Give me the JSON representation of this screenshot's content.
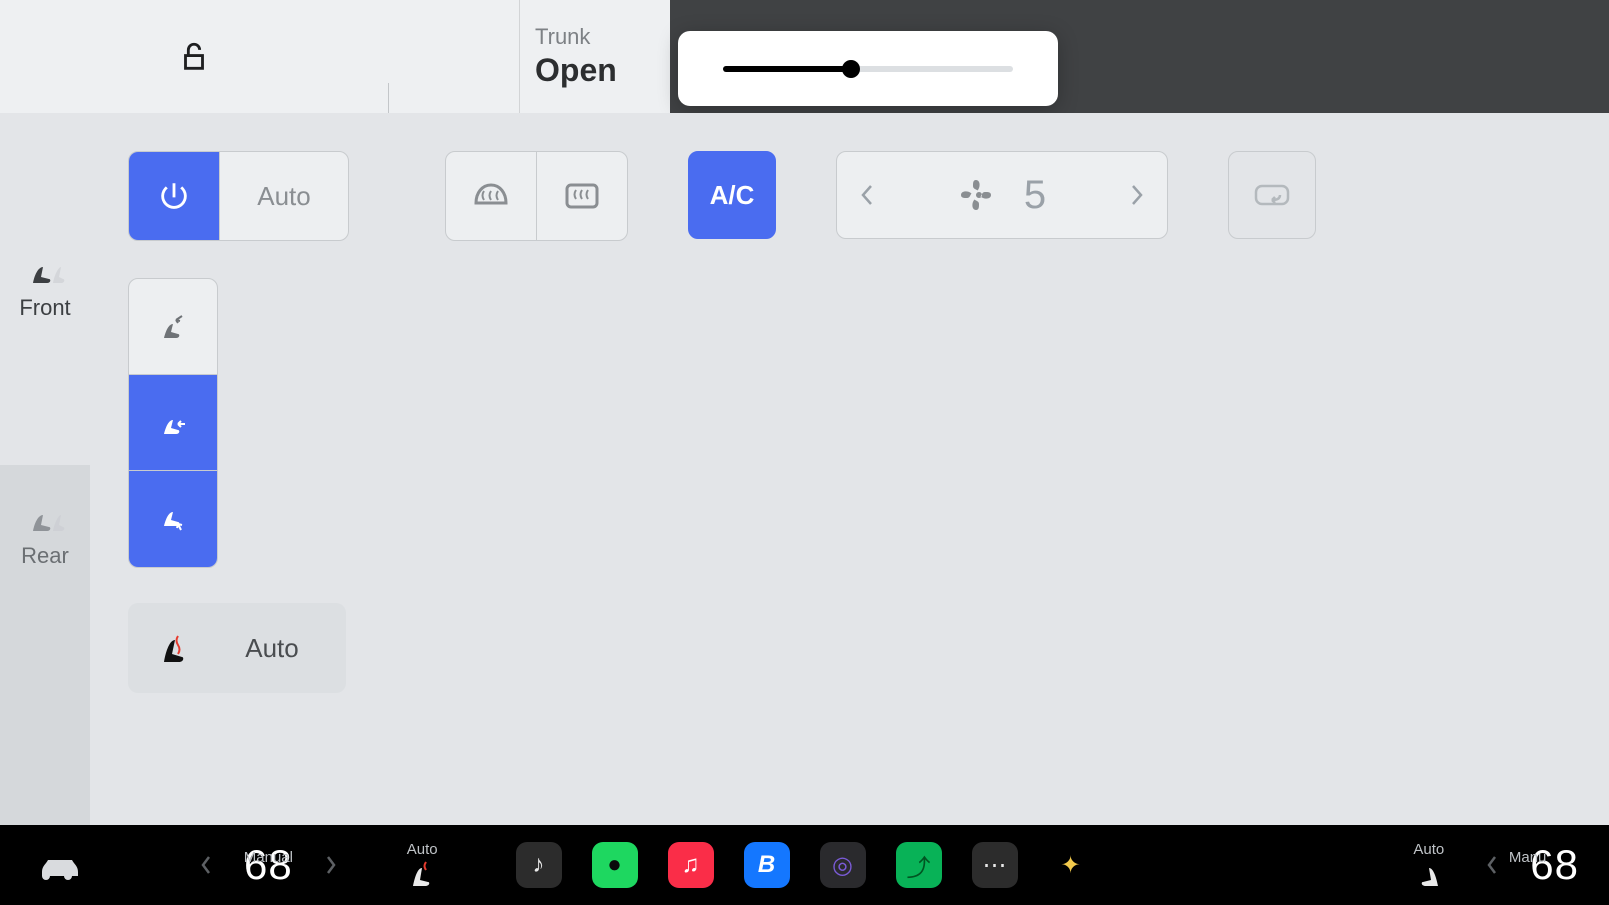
{
  "topbar": {
    "trunk_label": "Trunk",
    "trunk_value": "Open",
    "volume_percent": 44
  },
  "sidebar": {
    "front_label": "Front",
    "rear_label": "Rear"
  },
  "climate": {
    "power_on": true,
    "auto_label": "Auto",
    "ac_label": "A/C",
    "ac_on": true,
    "fan_speed": "5",
    "airflow": {
      "face": false,
      "body": true,
      "feet": true
    }
  },
  "seat": {
    "auto_label": "Auto"
  },
  "dock": {
    "left_mode": "Manual",
    "left_temp": "68",
    "heat_mode_left": "Auto",
    "right_mode_seat": "Auto",
    "right_mode": "Manu",
    "right_temp": "68",
    "apps": [
      {
        "name": "music",
        "bg": "#2c2c2c",
        "glyph": "♪",
        "color": "#e9e9e9"
      },
      {
        "name": "spotify",
        "bg": "#1ed760",
        "glyph": "●",
        "color": "#0a0a0a"
      },
      {
        "name": "applemusic",
        "bg": "#fa2d48",
        "glyph": "♫",
        "color": "#ffffff"
      },
      {
        "name": "bluetooth",
        "bg": "#1477ff",
        "glyph": "B",
        "color": "#ffffff"
      },
      {
        "name": "camera",
        "bg": "#2a2a2d",
        "glyph": "◎",
        "color": "#7a5bd6"
      },
      {
        "name": "stocks",
        "bg": "#08b257",
        "glyph": "⤴",
        "color": "#052"
      },
      {
        "name": "more",
        "bg": "#2c2c2c",
        "glyph": "⋯",
        "color": "#e9e9e9"
      },
      {
        "name": "home",
        "bg": "transparent",
        "glyph": "✦",
        "color": "#f2c94c"
      }
    ]
  }
}
